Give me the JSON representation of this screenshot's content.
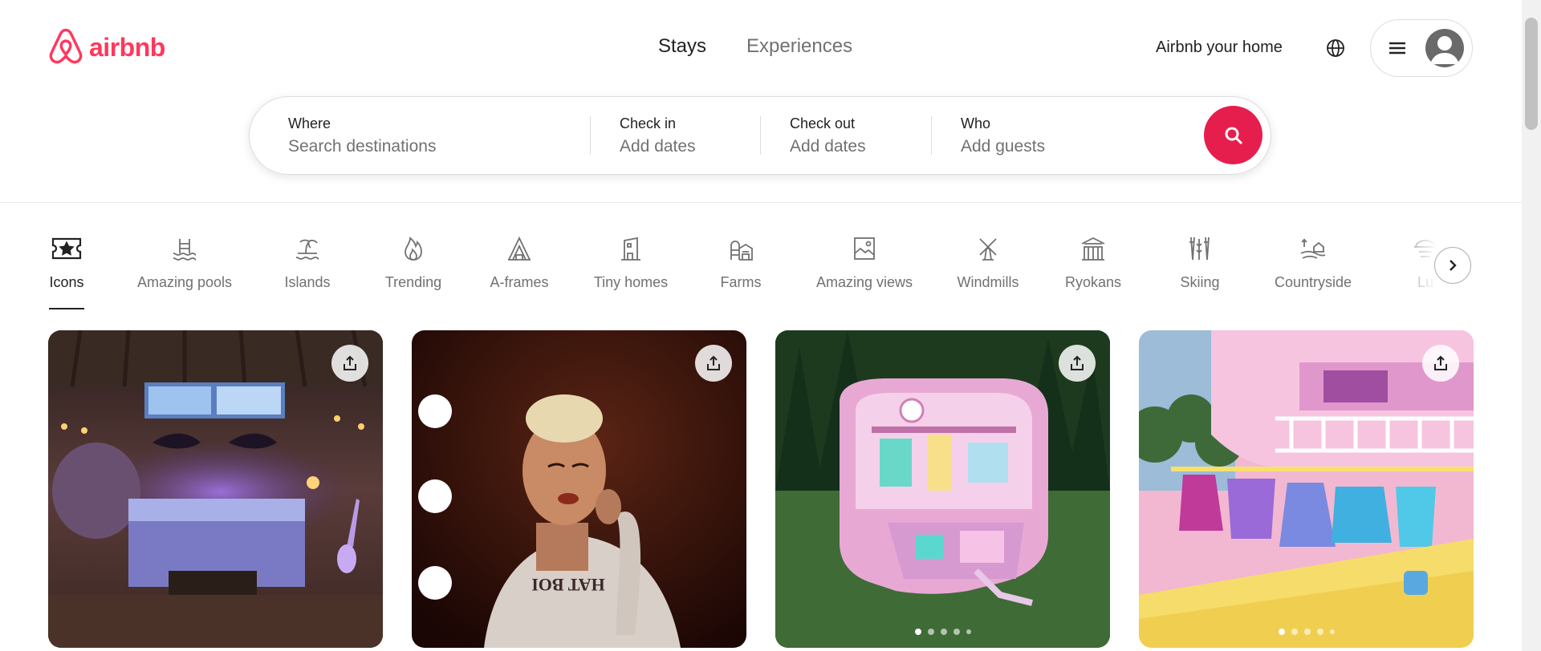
{
  "brand": {
    "name": "airbnb",
    "color": "#ff385c"
  },
  "nav": {
    "tabs": [
      {
        "label": "Stays"
      },
      {
        "label": "Experiences"
      }
    ],
    "host_link": "Airbnb your home",
    "icons": {
      "globe": "globe-icon",
      "menu": "hamburger-menu-icon",
      "avatar": "user-avatar-icon"
    }
  },
  "search": {
    "where": {
      "label": "Where",
      "placeholder": "Search destinations"
    },
    "check_in": {
      "label": "Check in",
      "value": "Add dates"
    },
    "check_out": {
      "label": "Check out",
      "value": "Add dates"
    },
    "who": {
      "label": "Who",
      "value": "Add guests"
    },
    "button_icon": "search-icon",
    "button_color": "#e61e4d"
  },
  "categories": [
    {
      "label": "Icons",
      "icon": "ticket-star-icon"
    },
    {
      "label": "Amazing pools",
      "icon": "pool-icon"
    },
    {
      "label": "Islands",
      "icon": "island-icon"
    },
    {
      "label": "Trending",
      "icon": "flame-icon"
    },
    {
      "label": "A-frames",
      "icon": "a-frame-icon"
    },
    {
      "label": "Tiny homes",
      "icon": "tiny-home-icon"
    },
    {
      "label": "Farms",
      "icon": "farm-icon"
    },
    {
      "label": "Amazing views",
      "icon": "view-icon"
    },
    {
      "label": "Windmills",
      "icon": "windmill-icon"
    },
    {
      "label": "Ryokans",
      "icon": "ryokan-icon"
    },
    {
      "label": "Skiing",
      "icon": "skiing-icon"
    },
    {
      "label": "Countryside",
      "icon": "countryside-icon"
    },
    {
      "label": "Lu",
      "icon": "luxe-icon"
    }
  ],
  "active_category": "Icons",
  "listings": [
    {
      "share_icon": "share-icon",
      "dots": 0
    },
    {
      "share_icon": "share-icon",
      "dots": 0
    },
    {
      "share_icon": "share-icon",
      "dots": 5,
      "active_dot": 1
    },
    {
      "share_icon": "share-icon",
      "dots": 5,
      "active_dot": 1
    }
  ]
}
